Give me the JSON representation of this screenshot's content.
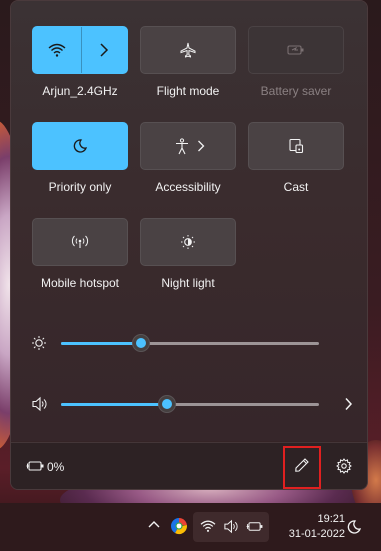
{
  "quick_settings": {
    "tiles": [
      {
        "id": "wifi",
        "label": "Arjun_2.4GHz",
        "state": "on",
        "icon": "wifi-icon",
        "has_chevron": true
      },
      {
        "id": "flight",
        "label": "Flight mode",
        "state": "off",
        "icon": "airplane-icon"
      },
      {
        "id": "battery-saver",
        "label": "Battery saver",
        "state": "disabled",
        "icon": "battery-saver-icon"
      },
      {
        "id": "priority",
        "label": "Priority only",
        "state": "on",
        "icon": "moon-icon"
      },
      {
        "id": "accessibility",
        "label": "Accessibility",
        "state": "off",
        "icon": "accessibility-icon",
        "has_chevron": true
      },
      {
        "id": "cast",
        "label": "Cast",
        "state": "off",
        "icon": "cast-icon"
      },
      {
        "id": "hotspot",
        "label": "Mobile hotspot",
        "state": "off",
        "icon": "hotspot-icon"
      },
      {
        "id": "nightlight",
        "label": "Night light",
        "state": "off",
        "icon": "night-light-icon"
      }
    ],
    "brightness": {
      "icon": "brightness-icon",
      "level": 0.31
    },
    "volume": {
      "icon": "speaker-icon",
      "level": 0.41,
      "has_chevron": true
    },
    "footer": {
      "battery_icon": "battery-charging-icon",
      "battery_text": "0%",
      "edit_icon": "pencil-icon",
      "settings_icon": "gear-icon"
    }
  },
  "taskbar": {
    "clock_time": "19:21",
    "clock_date": "31-01-2022",
    "icons": [
      "chevron-up-icon",
      "browser-icon",
      "wifi-icon",
      "speaker-icon",
      "battery-charging-icon",
      "moon-icon"
    ]
  },
  "colors": {
    "accent": "#4cc2ff",
    "highlight": "#e02020"
  }
}
